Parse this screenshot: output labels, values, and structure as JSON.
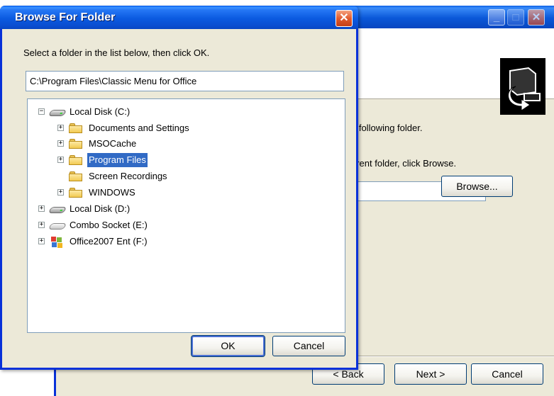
{
  "background_window": {
    "text_line1": "e following folder.",
    "text_line2": "erent folder, click Browse.",
    "browse_label": "Browse...",
    "back_label": "< Back",
    "next_label": "Next >",
    "cancel_label": "Cancel",
    "path_value": ""
  },
  "dialog": {
    "title": "Browse For Folder",
    "instruction": "Select a folder in the list below, then click OK.",
    "path_value": "C:\\Program Files\\Classic Menu for Office",
    "ok_label": "OK",
    "cancel_label": "Cancel",
    "tree": [
      {
        "label": "Local Disk (C:)",
        "icon": "hard-disk-icon",
        "toggle": "−",
        "selected": false
      },
      {
        "label": "Documents and Settings",
        "icon": "folder-icon",
        "toggle": "+",
        "selected": false
      },
      {
        "label": "MSOCache",
        "icon": "folder-icon",
        "toggle": "+",
        "selected": false
      },
      {
        "label": "Program Files",
        "icon": "folder-icon",
        "toggle": "+",
        "selected": true
      },
      {
        "label": "Screen Recordings",
        "icon": "folder-icon",
        "toggle": "",
        "selected": false
      },
      {
        "label": "WINDOWS",
        "icon": "folder-icon",
        "toggle": "+",
        "selected": false
      },
      {
        "label": "Local Disk  (D:)",
        "icon": "hard-disk-icon",
        "toggle": "+",
        "selected": false
      },
      {
        "label": "Combo Socket (E:)",
        "icon": "cd-drive-icon",
        "toggle": "+",
        "selected": false
      },
      {
        "label": "Office2007 Ent (F:)",
        "icon": "office-disc-icon",
        "toggle": "+",
        "selected": false
      }
    ]
  },
  "colors": {
    "title_bar_blue": "#0a5ae0",
    "selection_blue": "#316ac5",
    "close_red": "#e15b2f",
    "window_face": "#ece9d8"
  }
}
